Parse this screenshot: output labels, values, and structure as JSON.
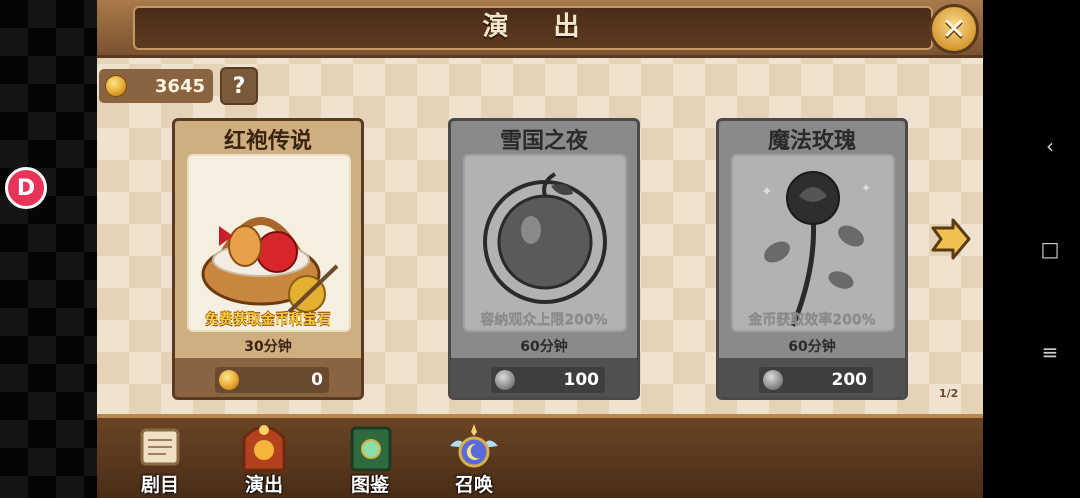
{
  "header": {
    "title": "演 出"
  },
  "currency": {
    "coins": "3645",
    "help_label": "?"
  },
  "cards": [
    {
      "title": "红袍传说",
      "desc": "免费获取金币和宝石",
      "duration": "30分钟",
      "cost": "0",
      "state": "active"
    },
    {
      "title": "雪国之夜",
      "desc": "容纳观众上限200%",
      "duration": "60分钟",
      "cost": "100",
      "state": "locked"
    },
    {
      "title": "魔法玫瑰",
      "desc": "金币获取效率200%",
      "duration": "60分钟",
      "cost": "200",
      "state": "locked"
    }
  ],
  "pagination": {
    "text": "1/2"
  },
  "bottom_nav": [
    {
      "label": "剧目",
      "icon": "scroll-icon"
    },
    {
      "label": "演出",
      "icon": "stage-icon"
    },
    {
      "label": "图鉴",
      "icon": "book-icon"
    },
    {
      "label": "召唤",
      "icon": "summon-orb-icon"
    }
  ],
  "system_nav": {
    "back": "‹",
    "home": "□",
    "menu": "≡"
  },
  "colors": {
    "accent_gold": "#f6d23a",
    "frame_brown": "#5a3a22"
  }
}
